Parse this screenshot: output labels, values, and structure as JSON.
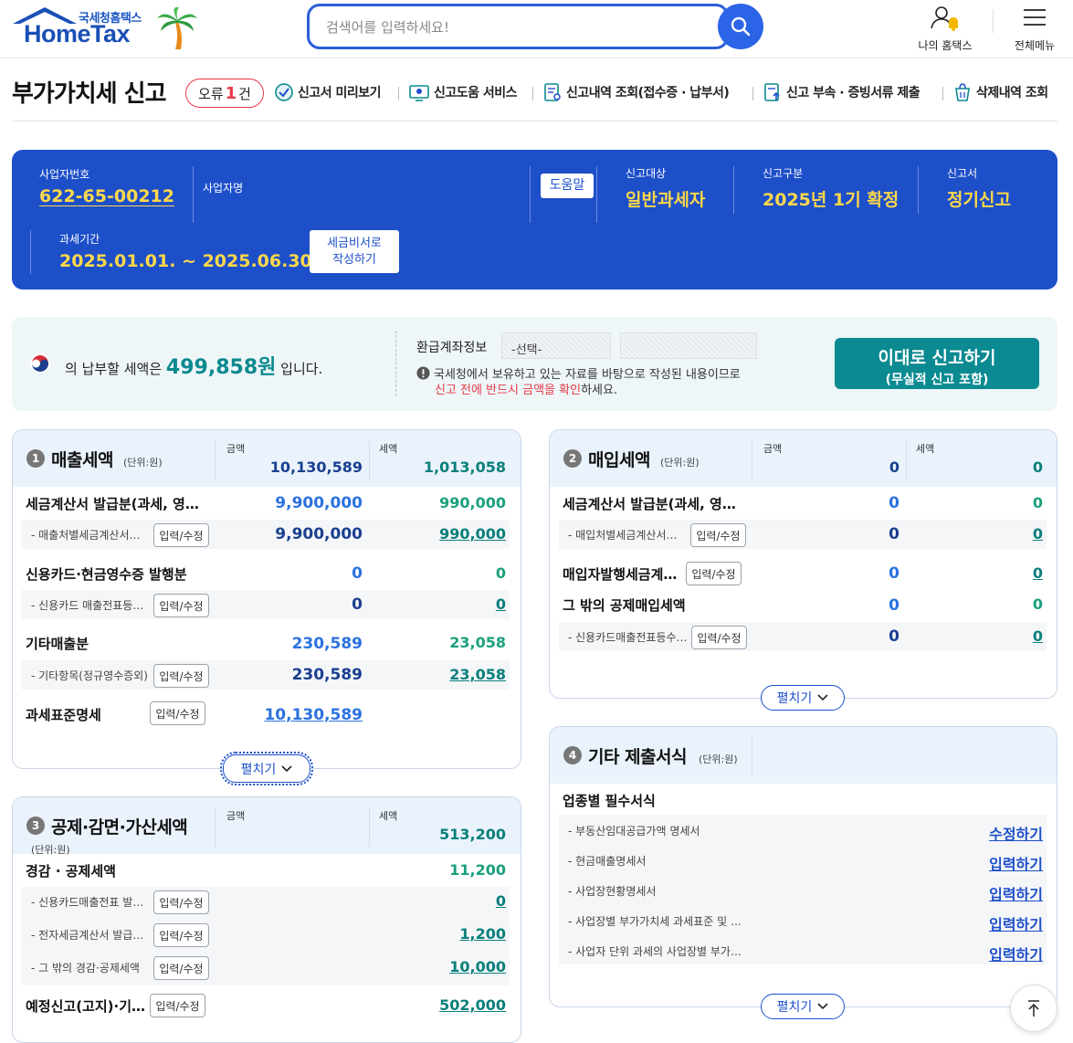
{
  "header": {
    "logo_small": "국세청홈택스",
    "logo_big": "HomeTax",
    "search_placeholder": "검색어를 입력하세요!",
    "my_hometax": "나의 홈택스",
    "all_menu": "전체메뉴"
  },
  "title": {
    "page_title": "부가가치세 신고",
    "error_label": "오류",
    "error_count": "1",
    "error_unit": "건",
    "links": [
      "신고서 미리보기",
      "신고도움 서비스",
      "신고내역 조회(접수증 · 납부서)",
      "신고 부속 · 증빙서류 제출",
      "삭제내역 조회"
    ]
  },
  "business": {
    "bizno_label": "사업자번호",
    "bizno": "622-65-00212",
    "bizname_label": "사업자명",
    "help_btn": "도움말",
    "target_label": "신고대상",
    "target": "일반과세자",
    "type_label": "신고구분",
    "type": "2025년 1기 확정",
    "form_label": "신고서",
    "form": "정기신고",
    "period_label": "과세기간",
    "period": "2025.01.01. ~ 2025.06.30.",
    "secretary_btn_l1": "세금비서로",
    "secretary_btn_l2": "작성하기"
  },
  "taxbar": {
    "pre": "의 납부할 세액은",
    "amount": "499,858원",
    "post": "입니다.",
    "refund_label": "환급계좌정보",
    "refund_select": "-선택-",
    "notice1": "국세청에서 보유하고 있는 자료를 바탕으로 작성된 내용이므로",
    "notice2_red": "신고 전에 반드시 금액을 확인",
    "notice2_tail": "하세요.",
    "file_btn_l1": "이대로 신고하기",
    "file_btn_l2": "(무실적 신고 포함)"
  },
  "common": {
    "amount_col": "금액",
    "tax_col": "세액",
    "unit": "(단위:원)",
    "input_btn": "입력/수정",
    "expand_btn": "펼치기"
  },
  "sales": {
    "num": "1",
    "title": "매출세액",
    "total_amount": "10,130,589",
    "total_tax": "1,013,058",
    "r1_label": "세금계산서 발급분(과세, 영세율)",
    "r1_amount": "9,900,000",
    "r1_tax": "990,000",
    "r1s_label": "- 매출처별세금계산서합계표",
    "r1s_amount": "9,900,000",
    "r1s_tax": "990,000",
    "r2_label": "신용카드·현금영수증 발행분",
    "r2_amount": "0",
    "r2_tax": "0",
    "r2s_label": "- 신용카드 매출전표등발행금액",
    "r2s_amount": "0",
    "r2s_tax": "0",
    "r3_label": "기타매출분",
    "r3_amount": "230,589",
    "r3_tax": "23,058",
    "r3s_label": "- 기타항목(정규영수증외)",
    "r3s_amount": "230,589",
    "r3s_tax": "23,058",
    "r4_label": "과세표준명세",
    "r4_amount": "10,130,589"
  },
  "purchase": {
    "num": "2",
    "title": "매입세액",
    "total_amount": "0",
    "total_tax": "0",
    "r1_label": "세금계산서 발급분(과세, 영세율)",
    "r1_amount": "0",
    "r1_tax": "0",
    "r1s_label": "- 매입처별세금계산서합계표",
    "r1s_amount": "0",
    "r1s_tax": "0",
    "r2_label": "매입자발행세금계산서",
    "r2_amount": "0",
    "r2_tax": "0",
    "r3_label": "그 밖의 공제매입세액",
    "r3_amount": "0",
    "r3_tax": "0",
    "r3s_label": "- 신용카드매출전표등수령명세서",
    "r3s_amount": "0",
    "r3s_tax": "0"
  },
  "deduction": {
    "num": "3",
    "title": "공제·감면·가산세액",
    "total_tax": "513,200",
    "r1_label": "경감 · 공제세액",
    "r1_tax": "11,200",
    "r1s1_label": "- 신용카드매출전표 발행공제",
    "r1s1_tax": "0",
    "r1s2_label": "- 전자세금계산서 발급세액공제",
    "r1s2_tax": "1,200",
    "r1s3_label": "- 그 밖의 경감·공제세액",
    "r1s3_tax": "10,000",
    "r2_label": "예정신고(고지)·기납부세액",
    "r2_tax": "502,000"
  },
  "other": {
    "num": "4",
    "title": "기타 제출서식",
    "req_label": "업종별 필수서식",
    "docs": [
      {
        "label": "- 부동산임대공급가액 명세서",
        "action": "수정하기"
      },
      {
        "label": "- 현금매출명세서",
        "action": "입력하기"
      },
      {
        "label": "- 사업장현황명세서",
        "action": "입력하기"
      },
      {
        "label": "- 사업장별 부가가치세 과세표준 및 납부세액 신고명세서",
        "action": "입력하기"
      },
      {
        "label": "- 사업자 단위 과세의 사업장별 부가가치세 과세표준",
        "action": "입력하기"
      }
    ]
  },
  "colors": {
    "brand_blue": "#1d4fc9",
    "teal": "#0b8a91",
    "yellow": "#ffd84a",
    "error_red": "#e63946"
  }
}
